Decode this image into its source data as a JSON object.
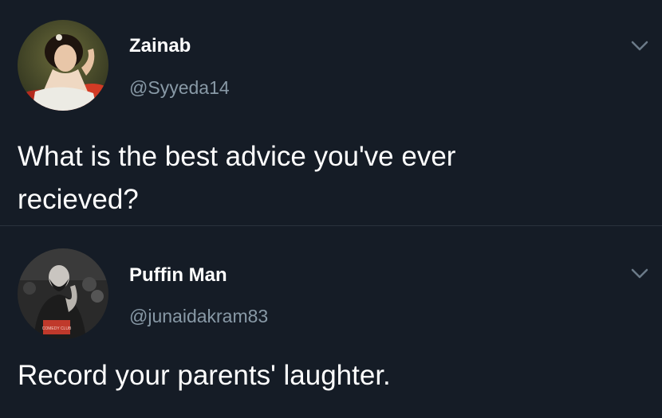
{
  "tweets": [
    {
      "display_name": "Zainab",
      "handle": "@Syyeda14",
      "text_lines": [
        "What is the best advice you've ever",
        "recieved?"
      ],
      "avatar_icon": "victorian-portrait-avatar",
      "menu_icon": "chevron-down-icon"
    },
    {
      "display_name": "Puffin Man",
      "handle": "@junaidakram83",
      "text_lines": [
        "Record your parents' laughter."
      ],
      "avatar_icon": "comedy-club-photo-avatar",
      "avatar_sign_text": "COMEDY CLUB",
      "menu_icon": "chevron-down-icon"
    }
  ],
  "colors": {
    "background": "#151c26",
    "text": "#ffffff",
    "secondary_text": "#8899a6",
    "divider": "#2a323d"
  }
}
